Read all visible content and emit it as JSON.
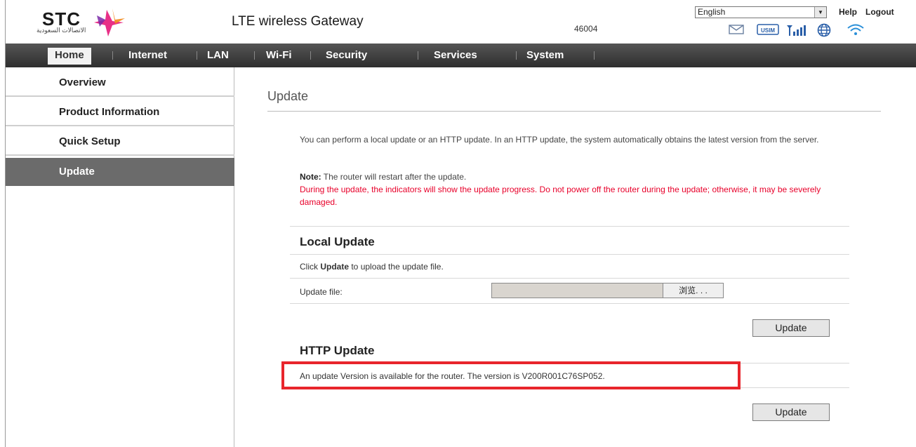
{
  "header": {
    "logo_text": "STC",
    "logo_subtext": "الاتصالات السعودية",
    "gateway_title": "LTE wireless Gateway",
    "plmn": "46004",
    "language": "English",
    "help_label": "Help",
    "logout_label": "Logout",
    "status_icons": [
      "sms-icon",
      "usim-icon",
      "signal-icon",
      "globe-icon",
      "wifi-icon"
    ],
    "usim_text": "USIM"
  },
  "nav": {
    "items": [
      "Home",
      "Internet",
      "LAN",
      "Wi-Fi",
      "Security",
      "Services",
      "System"
    ],
    "active": "Home"
  },
  "sidebar": {
    "items": [
      "Overview",
      "Product Information",
      "Quick Setup",
      "Update"
    ],
    "active": "Update"
  },
  "main": {
    "title": "Update",
    "intro": "You can perform a local update or an HTTP update. In an HTTP update, the system automatically obtains the latest version from the server.",
    "note_label": "Note:",
    "note_text": " The router will restart after the update.",
    "warning": "During the update, the indicators will show the update progress. Do not power off the router during the update; otherwise, it may be severely damaged.",
    "local_update": {
      "title": "Local Update",
      "instruction_prefix": "Click ",
      "instruction_bold": "Update",
      "instruction_suffix": " to upload the update file.",
      "file_label": "Update file:",
      "browse_label": "浏览. . .",
      "button_label": "Update"
    },
    "http_update": {
      "title": "HTTP Update",
      "message": "An update Version is available for the router. The version is V200R001C76SP052.",
      "button_label": "Update"
    }
  },
  "colors": {
    "nav_bg": "#3d3d3d",
    "sidebar_active": "#6b6b6b",
    "warning_text": "#e8002a",
    "highlight": "#e8252c"
  }
}
